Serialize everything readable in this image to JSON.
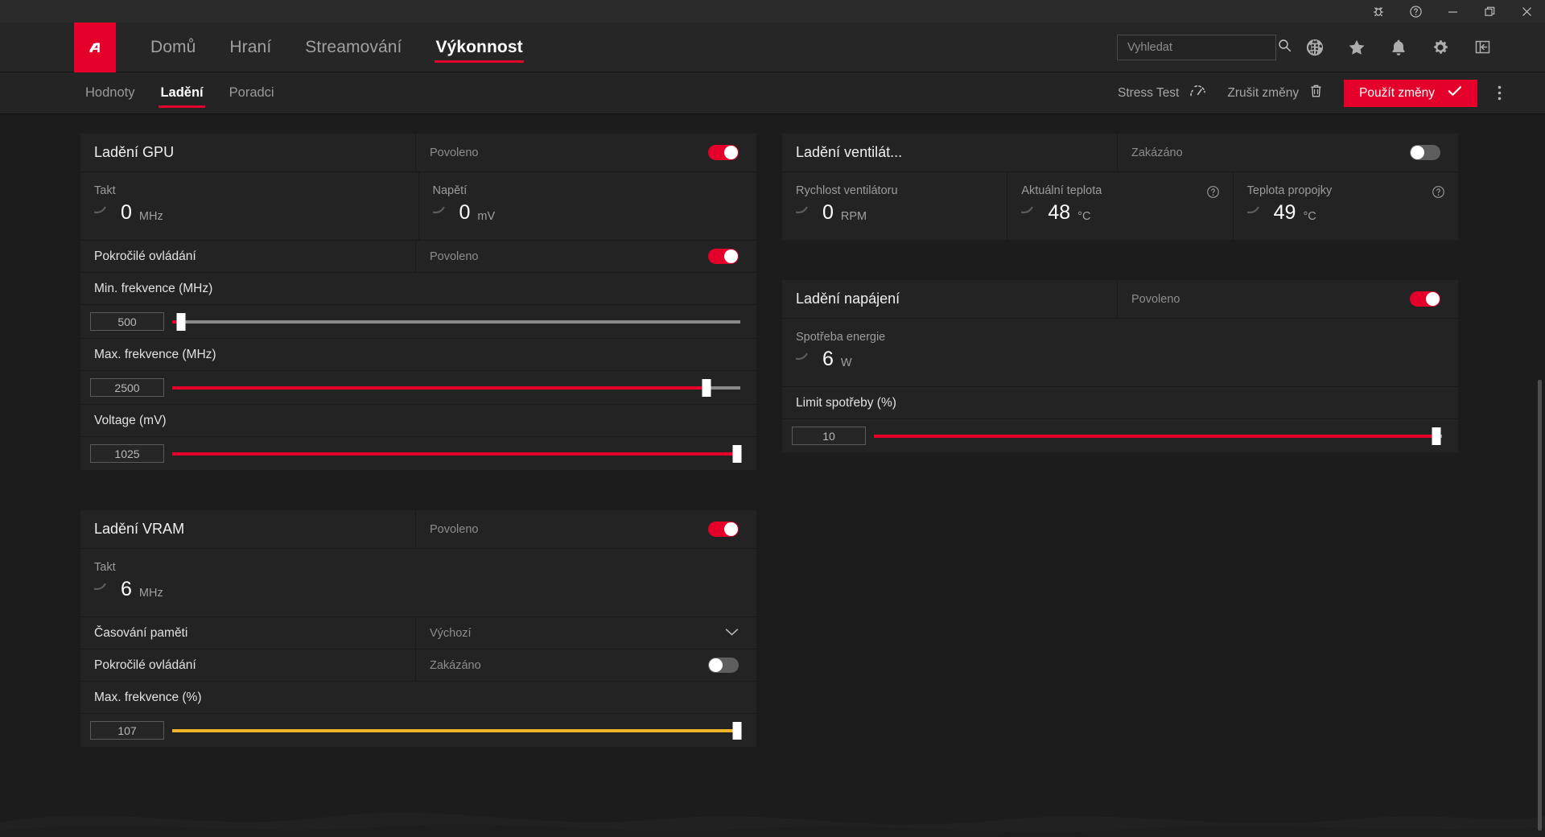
{
  "titlebar": {
    "buttons": [
      {
        "name": "bug-icon",
        "label": "Report bug"
      },
      {
        "name": "help-icon",
        "label": "Help"
      },
      {
        "name": "minimize-icon",
        "label": "Minimize"
      },
      {
        "name": "restore-icon",
        "label": "Restore"
      },
      {
        "name": "close-icon",
        "label": "Close"
      }
    ]
  },
  "mainnav": {
    "logo_alt": "AMD",
    "tabs": [
      {
        "label": "Domů",
        "active": false
      },
      {
        "label": "Hraní",
        "active": false
      },
      {
        "label": "Streamování",
        "active": false
      },
      {
        "label": "Výkonnost",
        "active": true
      }
    ],
    "search": {
      "value": "",
      "placeholder": "Vyhledat"
    },
    "icons": [
      "globe-icon",
      "star-icon",
      "bell-icon",
      "gear-icon",
      "collapse-panel-icon"
    ]
  },
  "subnav": {
    "tabs": [
      {
        "label": "Hodnoty",
        "active": false
      },
      {
        "label": "Ladění",
        "active": true
      },
      {
        "label": "Poradci",
        "active": false
      }
    ],
    "stress_test": "Stress Test",
    "discard": "Zrušit změny",
    "apply": "Použít změny"
  },
  "colors": {
    "accent": "#e4002b",
    "slider_red": "#e4002b",
    "slider_yellow": "#f0b429",
    "track_grey": "#8a8a8a",
    "panel_bg": "#232323",
    "page_bg": "#1c1c1c"
  },
  "gpu_tuning": {
    "title": "Ladění GPU",
    "enable_state": "Povoleno",
    "enabled": true,
    "metrics": [
      {
        "label": "Takt",
        "value": "0",
        "unit": "MHz",
        "arc_pct": 0,
        "arc_color": "#6e6e6e"
      },
      {
        "label": "Napětí",
        "value": "0",
        "unit": "mV",
        "arc_pct": 0,
        "arc_color": "#6e6e6e"
      }
    ],
    "advanced_label": "Pokročilé ovládání",
    "advanced_state": "Povoleno",
    "advanced_enabled": true,
    "sliders": [
      {
        "label": "Min. frekvence (MHz)",
        "value": "500",
        "pct": 1.5,
        "color": "#e4002b",
        "filled": false
      },
      {
        "label": "Max. frekvence (MHz)",
        "value": "2500",
        "pct": 94,
        "color": "#e4002b",
        "filled": true
      },
      {
        "label": "Voltage (mV)",
        "value": "1025",
        "pct": 99.5,
        "color": "#e4002b",
        "filled": true
      }
    ]
  },
  "vram_tuning": {
    "title": "Ladění VRAM",
    "enable_state": "Povoleno",
    "enabled": true,
    "metrics": [
      {
        "label": "Takt",
        "value": "6",
        "unit": "MHz",
        "arc_pct": 3,
        "arc_color": "#f0b429"
      }
    ],
    "memory_timing_label": "Časování paměti",
    "memory_timing_value": "Výchozí",
    "advanced_label": "Pokročilé ovládání",
    "advanced_state": "Zakázáno",
    "advanced_enabled": false,
    "sliders": [
      {
        "label": "Max. frekvence (%)",
        "value": "107",
        "pct": 99.5,
        "color": "#f0b429",
        "filled": true
      }
    ]
  },
  "fan_tuning": {
    "title": "Ladění ventilát...",
    "enable_state": "Zakázáno",
    "enabled": false,
    "metrics": [
      {
        "label": "Rychlost ventilátoru",
        "value": "0",
        "unit": "RPM",
        "arc_pct": 0,
        "arc_color": "#6e6e6e",
        "help": false
      },
      {
        "label": "Aktuální teplota",
        "value": "48",
        "unit": "°C",
        "arc_pct": 48,
        "arc_color": "#e4002b",
        "help": true
      },
      {
        "label": "Teplota propojky",
        "value": "49",
        "unit": "°C",
        "arc_pct": 49,
        "arc_color": "#e4002b",
        "help": true
      }
    ]
  },
  "power_tuning": {
    "title": "Ladění napájení",
    "enable_state": "Povoleno",
    "enabled": true,
    "metrics": [
      {
        "label": "Spotřeba energie",
        "value": "6",
        "unit": "W",
        "arc_pct": 4,
        "arc_color": "#e4002b"
      }
    ],
    "sliders": [
      {
        "label": "Limit spotřeby (%)",
        "value": "10",
        "pct": 99,
        "color": "#e4002b",
        "filled": true
      }
    ]
  }
}
